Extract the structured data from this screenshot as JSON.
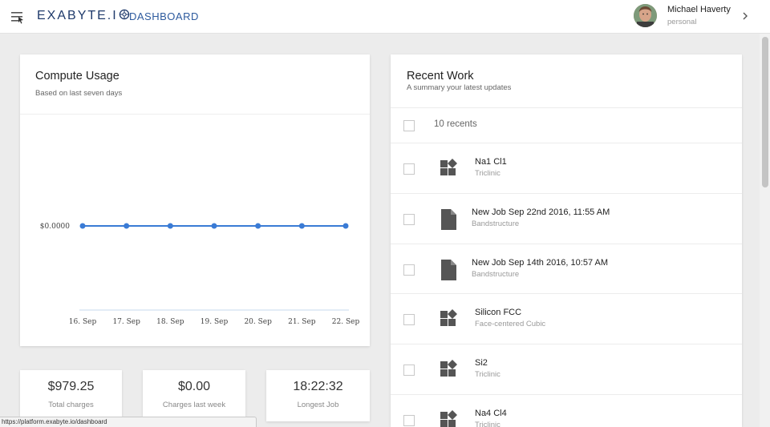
{
  "header": {
    "logo_text": "EXABYTE.I",
    "title": "DASHBOARD",
    "user_name": "Michael Haverty",
    "user_account": "personal",
    "icons": [
      "menu-icon",
      "logo-gear-icon",
      "chevron-right-icon"
    ]
  },
  "usage": {
    "title": "Compute Usage",
    "subtitle": "Based on last seven days"
  },
  "chart_data": {
    "type": "line",
    "categories": [
      "16. Sep",
      "17. Sep",
      "18. Sep",
      "19. Sep",
      "20. Sep",
      "21. Sep",
      "22. Sep"
    ],
    "values": [
      0,
      0,
      0,
      0,
      0,
      0,
      0
    ],
    "y_tick_labels": [
      "$0.0000"
    ],
    "line_color": "#3a7bd5",
    "grid": false
  },
  "stats": [
    {
      "value": "$979.25",
      "label": "Total charges"
    },
    {
      "value": "$0.00",
      "label": "Charges last week"
    },
    {
      "value": "18:22:32",
      "label": "Longest Job"
    }
  ],
  "recent": {
    "title": "Recent Work",
    "subtitle": "A summary your latest updates",
    "count_label": "10 recents",
    "items": [
      {
        "title": "Na1 Cl1",
        "subtitle": "Triclinic",
        "icon": "material-icon"
      },
      {
        "title": "New Job Sep 22nd 2016, 11:55 AM",
        "subtitle": "Bandstructure",
        "icon": "document-icon"
      },
      {
        "title": "New Job Sep 14th 2016, 10:57 AM",
        "subtitle": "Bandstructure",
        "icon": "document-icon"
      },
      {
        "title": "Silicon FCC",
        "subtitle": "Face-centered Cubic",
        "icon": "material-icon"
      },
      {
        "title": "Si2",
        "subtitle": "Triclinic",
        "icon": "material-icon"
      },
      {
        "title": "Na4 Cl4",
        "subtitle": "Triclinic",
        "icon": "material-icon"
      }
    ]
  },
  "status_url": "https://platform.exabyte.io/dashboard",
  "colors": {
    "accent": "#3a7bd5",
    "brand": "#1f3a6b",
    "icon_gray": "#555555"
  }
}
